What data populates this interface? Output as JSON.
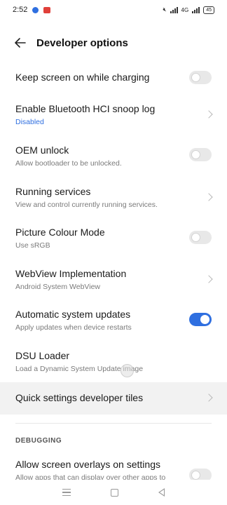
{
  "status_bar": {
    "time": "2:52",
    "network": "4G",
    "battery": "45"
  },
  "header": {
    "title": "Developer options"
  },
  "items": [
    {
      "title": "Keep screen on while charging",
      "subtitle": "",
      "control": "toggle",
      "on": false
    },
    {
      "title": "Enable Bluetooth HCI snoop log",
      "subtitle": "Disabled",
      "control": "chevron"
    },
    {
      "title": "OEM unlock",
      "subtitle": "Allow bootloader to be unlocked.",
      "control": "toggle",
      "on": false
    },
    {
      "title": "Running services",
      "subtitle": "View and control currently running services.",
      "control": "chevron"
    },
    {
      "title": "Picture Colour Mode",
      "subtitle": "Use sRGB",
      "control": "toggle",
      "on": false
    },
    {
      "title": "WebView Implementation",
      "subtitle": "Android System WebView",
      "control": "chevron"
    },
    {
      "title": "Automatic system updates",
      "subtitle": "Apply updates when device restarts",
      "control": "toggle",
      "on": true
    },
    {
      "title": "DSU Loader",
      "subtitle": "Load a Dynamic System Update image",
      "control": "none"
    },
    {
      "title": "Quick settings developer tiles",
      "subtitle": "",
      "control": "chevron"
    },
    {
      "title": "Allow screen overlays on settings",
      "subtitle": "Allow apps that can display over other apps to",
      "control": "toggle",
      "on": false
    }
  ],
  "section": {
    "debugging_header": "DEBUGGING"
  },
  "colors": {
    "accent": "#2f6fe0",
    "highlight_row": "#f2f2f2"
  }
}
